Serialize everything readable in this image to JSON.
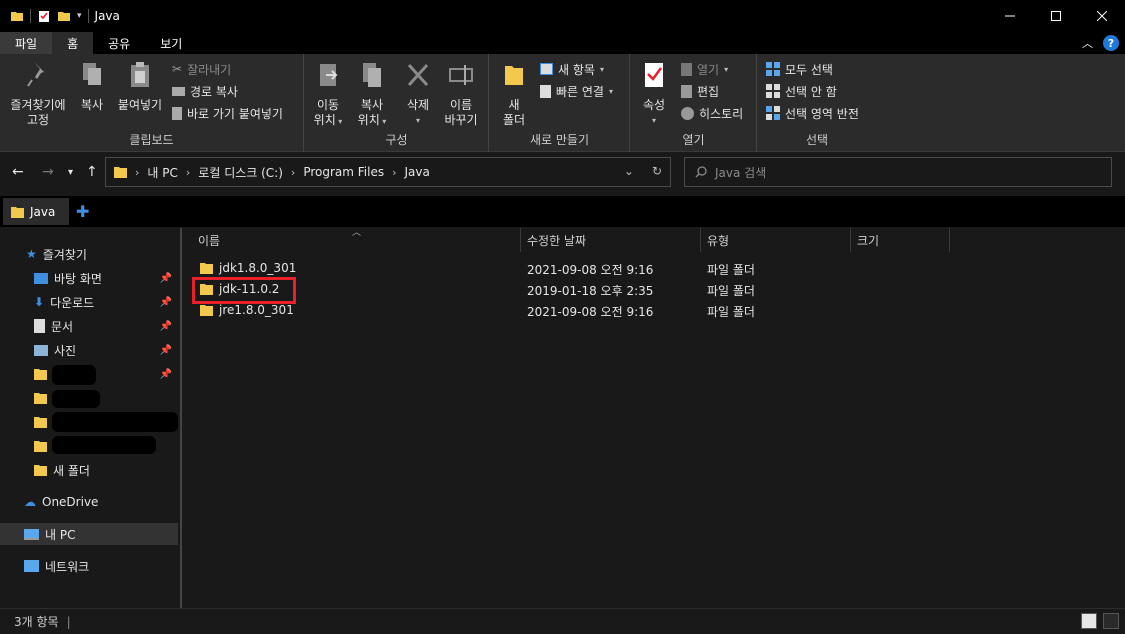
{
  "window": {
    "title": "Java"
  },
  "ribbon_tabs": [
    "파일",
    "홈",
    "공유",
    "보기"
  ],
  "ribbon": {
    "clipboard": {
      "label": "클립보드",
      "pin": "즐겨찾기에 고정",
      "copy": "복사",
      "paste": "붙여넣기",
      "cut": "잘라내기",
      "copy_path": "경로 복사",
      "paste_shortcut": "바로 가기 붙여넣기"
    },
    "organize": {
      "label": "구성",
      "move_to_1": "이동",
      "move_to_2": "위치",
      "copy_to_1": "복사",
      "copy_to_2": "위치",
      "delete": "삭제",
      "rename_1": "이름",
      "rename_2": "바꾸기"
    },
    "new": {
      "label": "새로 만들기",
      "new_folder_1": "새",
      "new_folder_2": "폴더",
      "new_item": "새 항목",
      "easy_access": "빠른 연결"
    },
    "open": {
      "label": "열기",
      "properties": "속성",
      "open": "열기",
      "edit": "편집",
      "history": "히스토리"
    },
    "select": {
      "label": "선택",
      "select_all": "모두 선택",
      "select_none": "선택 안 함",
      "invert": "선택 영역 반전"
    }
  },
  "address": {
    "crumbs": [
      "내 PC",
      "로컬 디스크 (C:)",
      "Program Files",
      "Java"
    ]
  },
  "search": {
    "placeholder": "Java 검색"
  },
  "tab": {
    "label": "Java"
  },
  "nav": {
    "quick_access": "즐겨찾기",
    "desktop": "바탕 화면",
    "downloads": "다운로드",
    "documents": "문서",
    "pictures": "사진",
    "new_folder": "새 폴더",
    "onedrive": "OneDrive",
    "this_pc": "내 PC",
    "network": "네트워크"
  },
  "columns": {
    "name": "이름",
    "date": "수정한 날짜",
    "type": "유형",
    "size": "크기"
  },
  "files": [
    {
      "name": "jdk1.8.0_301",
      "date": "2021-09-08 오전 9:16",
      "type": "파일 폴더"
    },
    {
      "name": "jdk-11.0.2",
      "date": "2019-01-18 오후 2:35",
      "type": "파일 폴더"
    },
    {
      "name": "jre1.8.0_301",
      "date": "2021-09-08 오전 9:16",
      "type": "파일 폴더"
    }
  ],
  "status": {
    "count": "3개 항목"
  },
  "colors": {
    "folder": "#f2c94c",
    "highlight": "#e8202a",
    "accent": "#3f8fe0"
  }
}
